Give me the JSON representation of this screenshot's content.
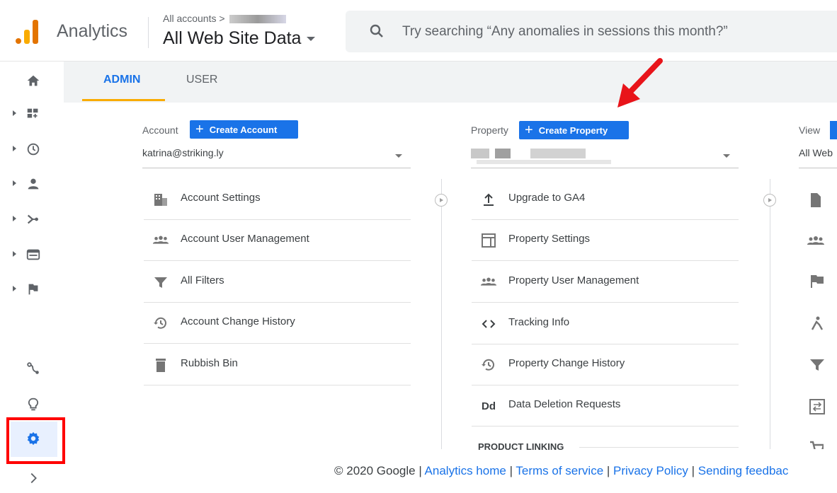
{
  "header": {
    "app_name": "Analytics",
    "breadcrumb": "All accounts >",
    "view_title": "All Web Site Data",
    "search_placeholder": "Try searching “Any anomalies in sessions this month?”"
  },
  "tabs": {
    "admin": "ADMIN",
    "user": "USER"
  },
  "account": {
    "label": "Account",
    "create_label": "Create Account",
    "selected": "katrina@striking.ly",
    "items": [
      {
        "label": "Account Settings",
        "icon": "building-icon"
      },
      {
        "label": "Account User Management",
        "icon": "people-icon"
      },
      {
        "label": "All Filters",
        "icon": "filter-icon"
      },
      {
        "label": "Account Change History",
        "icon": "history-icon"
      },
      {
        "label": "Rubbish Bin",
        "icon": "trash-icon"
      }
    ]
  },
  "property": {
    "label": "Property",
    "create_label": "Create Property",
    "items": [
      {
        "label": "Upgrade to GA4",
        "icon": "upload-icon"
      },
      {
        "label": "Property Settings",
        "icon": "settings-window-icon"
      },
      {
        "label": "Property User Management",
        "icon": "people-icon"
      },
      {
        "label": "Tracking Info",
        "icon": "code-icon"
      },
      {
        "label": "Property Change History",
        "icon": "history-icon"
      },
      {
        "label": "Data Deletion Requests",
        "icon": "dd-icon"
      }
    ],
    "section": "PRODUCT LINKING"
  },
  "view": {
    "label": "View",
    "selected": "All Web"
  },
  "footer": {
    "copyright": "© 2020 Google |",
    "links": [
      "Analytics home",
      "Terms of service",
      "Privacy Policy",
      "Sending feedbac"
    ],
    "separator": "|"
  },
  "colors": {
    "accent": "#1a73e8",
    "tab_underline": "#f9ab00",
    "highlight": "#ff0000",
    "logo_orange": "#f9ab00",
    "logo_dark": "#e37400"
  }
}
